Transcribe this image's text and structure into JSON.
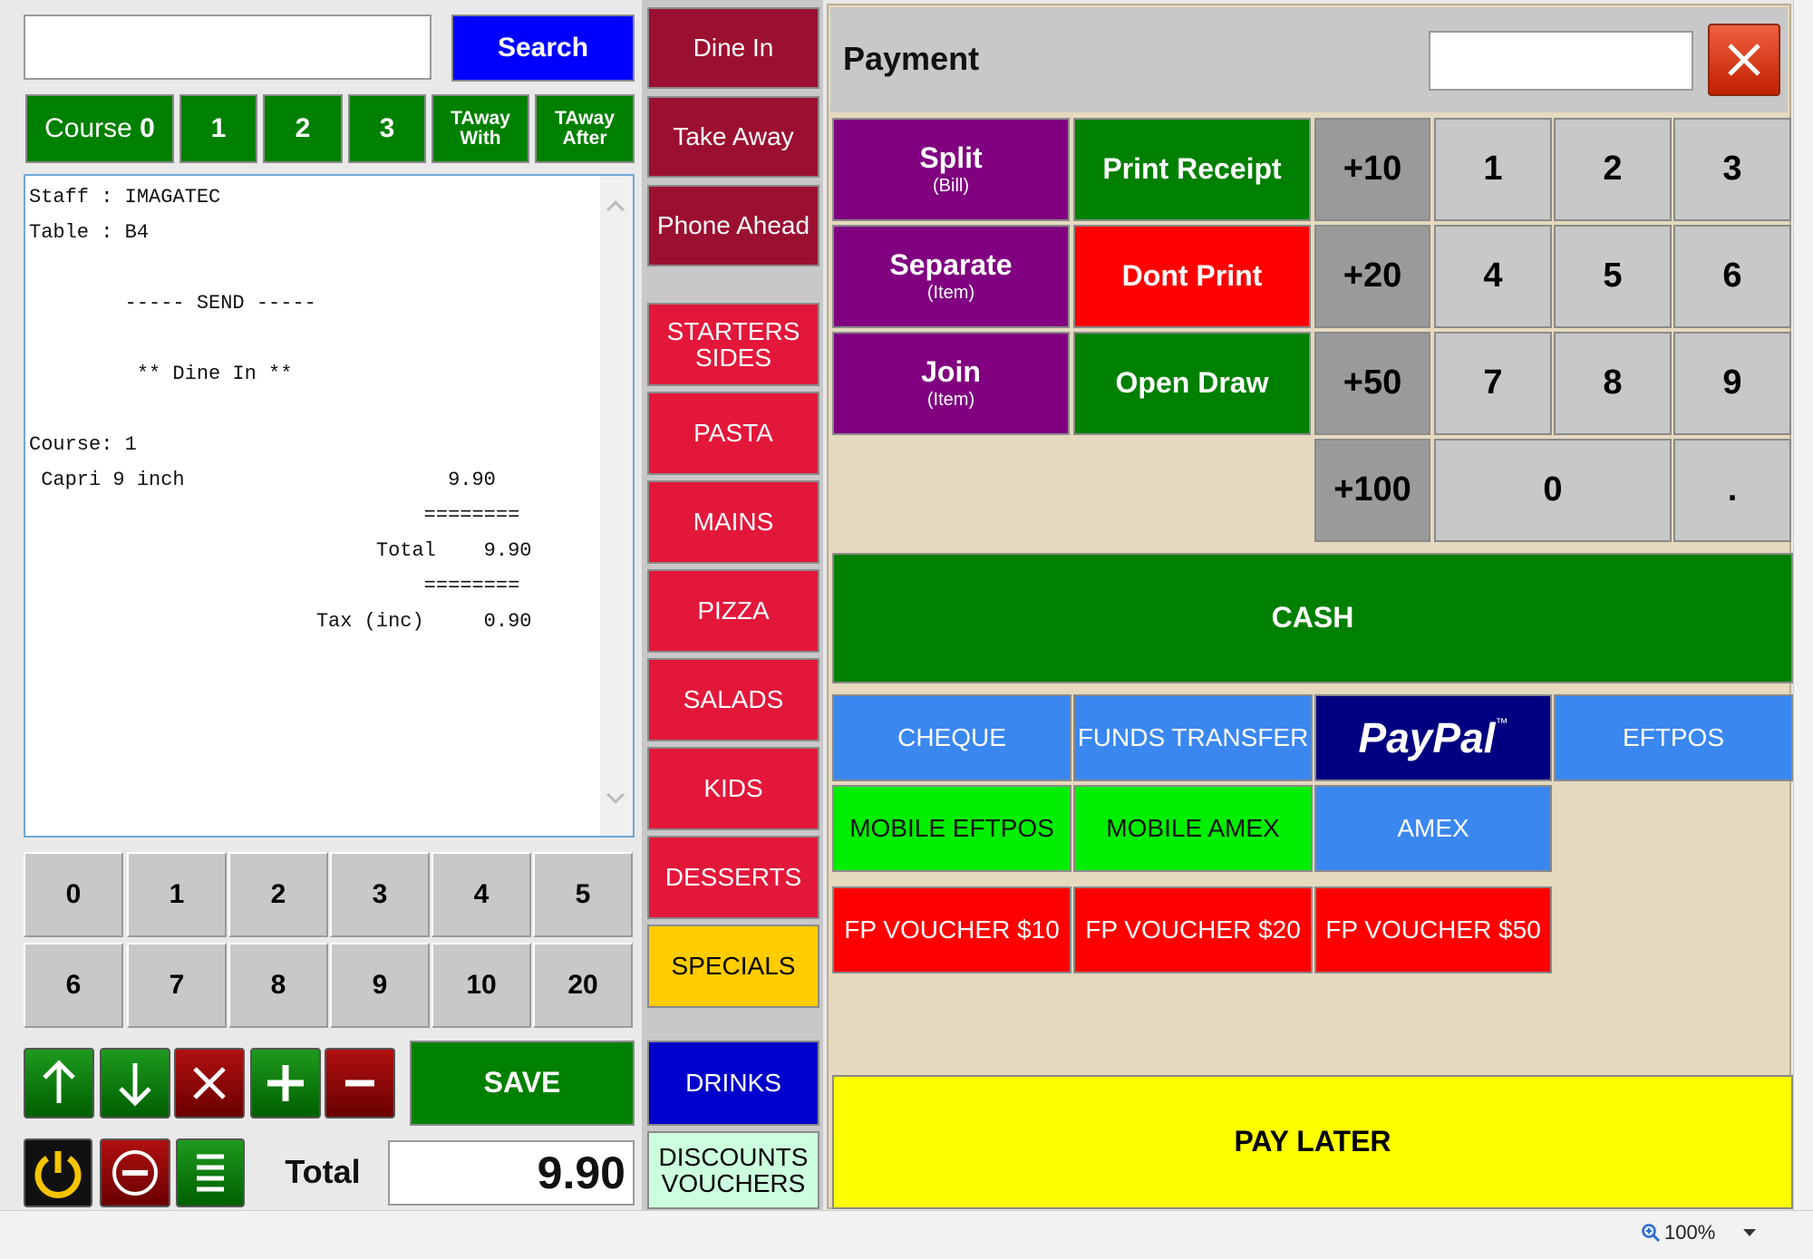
{
  "search": {
    "value": "",
    "button_label": "Search"
  },
  "course_buttons": [
    {
      "label": "Course ",
      "bold": "0"
    },
    {
      "label": "1"
    },
    {
      "label": "2"
    },
    {
      "label": "3"
    },
    {
      "label": "TAway With"
    },
    {
      "label": "TAway After"
    }
  ],
  "receipt": {
    "lines": [
      "Staff : IMAGATEC",
      "Table : B4",
      "",
      "        ----- SEND -----",
      "",
      "         ** Dine In **",
      "",
      "Course: 1",
      " Capri 9 inch                      9.90",
      "                                 ========",
      "                             Total    9.90",
      "                                 ========",
      "                        Tax (inc)     0.90"
    ]
  },
  "quantity_keys": [
    "0",
    "1",
    "2",
    "3",
    "4",
    "5",
    "6",
    "7",
    "8",
    "9",
    "10",
    "20"
  ],
  "controls": {
    "up_icon": "arrow-up-icon",
    "down_icon": "arrow-down-icon",
    "delete_icon": "close-icon",
    "plus_icon": "plus-icon",
    "minus_icon": "minus-icon",
    "save_label": "SAVE",
    "power_icon": "power-icon",
    "void_icon": "no-entry-icon",
    "menu_icon": "list-icon"
  },
  "total": {
    "label": "Total",
    "value": "9.90"
  },
  "order_types": [
    "Dine In",
    "Take Away",
    "Phone Ahead"
  ],
  "categories": [
    "STARTERS SIDES",
    "PASTA",
    "MAINS",
    "PIZZA",
    "SALADS",
    "KIDS",
    "DESSERTS",
    "SPECIALS"
  ],
  "drinks_label": "DRINKS",
  "discounts_label": "DISCOUNTS VOUCHERS",
  "payment": {
    "title": "Payment",
    "amount_value": "",
    "close_icon": "close-icon",
    "split": {
      "label": "Split",
      "sub": "(Bill)"
    },
    "separate": {
      "label": "Separate",
      "sub": "(Item)"
    },
    "join": {
      "label": "Join",
      "sub": "(Item)"
    },
    "print_receipt": "Print Receipt",
    "dont_print": "Dont Print",
    "open_draw": "Open Draw",
    "increments": [
      "+10",
      "+20",
      "+50",
      "+100"
    ],
    "keypad": [
      "1",
      "2",
      "3",
      "4",
      "5",
      "6",
      "7",
      "8",
      "9",
      "0",
      "."
    ],
    "cash": "CASH",
    "methods": {
      "cheque": "CHEQUE",
      "funds_transfer": "FUNDS TRANSFER",
      "paypal": "PayPal",
      "paypal_tm": "™",
      "eftpos": "EFTPOS",
      "mobile_eftpos": "MOBILE EFTPOS",
      "mobile_amex": "MOBILE AMEX",
      "amex": "AMEX",
      "voucher10": "FP VOUCHER $10",
      "voucher20": "FP VOUCHER $20",
      "voucher50": "FP VOUCHER $50"
    },
    "pay_later": "PAY LATER"
  },
  "statusbar": {
    "zoom": "100%",
    "zoom_icon": "zoom-icon",
    "dropdown_icon": "chevron-down-icon"
  }
}
